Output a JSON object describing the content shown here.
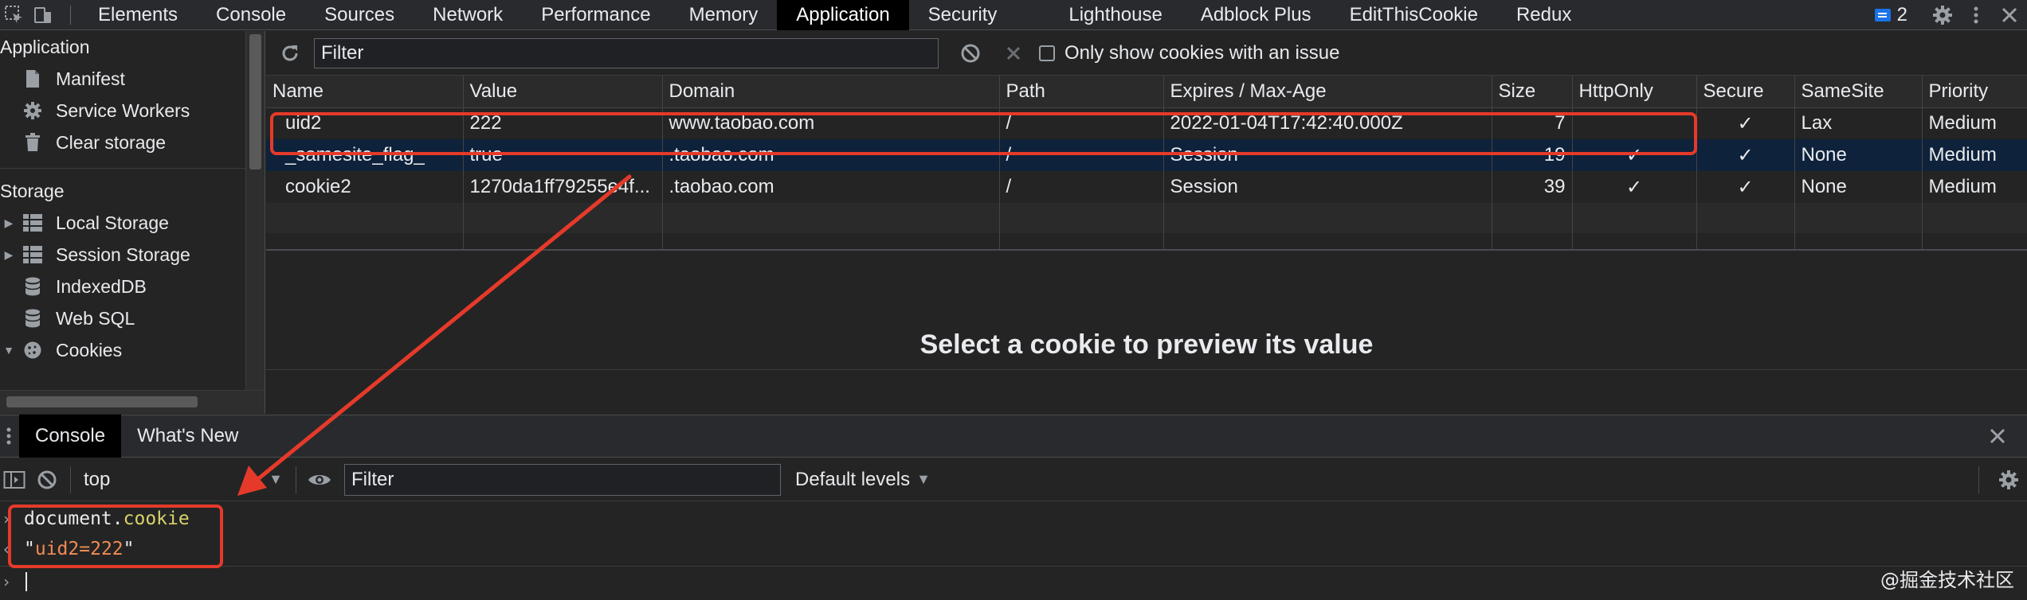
{
  "devtools": {
    "tabs": [
      "Elements",
      "Console",
      "Sources",
      "Network",
      "Performance",
      "Memory",
      "Application",
      "Security",
      "Lighthouse",
      "Adblock Plus",
      "EditThisCookie",
      "Redux"
    ],
    "active_tab": "Application",
    "message_count": "2"
  },
  "sidebar": {
    "application_heading": "Application",
    "application_items": [
      {
        "label": "Manifest",
        "icon": "document-icon"
      },
      {
        "label": "Service Workers",
        "icon": "gear-icon"
      },
      {
        "label": "Clear storage",
        "icon": "trash-icon"
      }
    ],
    "storage_heading": "Storage",
    "storage_items": [
      {
        "label": "Local Storage",
        "icon": "grid-icon",
        "expandable": true
      },
      {
        "label": "Session Storage",
        "icon": "grid-icon",
        "expandable": true
      },
      {
        "label": "IndexedDB",
        "icon": "database-icon",
        "expandable": false
      },
      {
        "label": "Web SQL",
        "icon": "database-icon",
        "expandable": false
      },
      {
        "label": "Cookies",
        "icon": "cookie-icon",
        "expandable": true,
        "expanded": true
      }
    ]
  },
  "cookie_toolbar": {
    "filter_placeholder": "Filter",
    "only_issue_label": "Only show cookies with an issue",
    "only_issue_checked": false
  },
  "cookie_table": {
    "columns": [
      "Name",
      "Value",
      "Domain",
      "Path",
      "Expires / Max-Age",
      "Size",
      "HttpOnly",
      "Secure",
      "SameSite",
      "Priority"
    ],
    "rows": [
      {
        "name": "uid2",
        "value": "222",
        "domain": "www.taobao.com",
        "path": "/",
        "expires": "2022-01-04T17:42:40.000Z",
        "size": "7",
        "httponly": "",
        "secure": "✓",
        "samesite": "Lax",
        "priority": "Medium",
        "selected": false
      },
      {
        "name": "_samesite_flag_",
        "value": "true",
        "domain": ".taobao.com",
        "path": "/",
        "expires": "Session",
        "size": "19",
        "httponly": "✓",
        "secure": "✓",
        "samesite": "None",
        "priority": "Medium",
        "selected": true
      },
      {
        "name": "cookie2",
        "value": "1270da1ff79255e4f...",
        "domain": ".taobao.com",
        "path": "/",
        "expires": "Session",
        "size": "39",
        "httponly": "✓",
        "secure": "✓",
        "samesite": "None",
        "priority": "Medium",
        "selected": false
      }
    ],
    "preview_message": "Select a cookie to preview its value"
  },
  "drawer": {
    "tabs": [
      "Console",
      "What's New"
    ],
    "active_tab": "Console",
    "context": "top",
    "filter_placeholder": "Filter",
    "levels_label": "Default levels"
  },
  "console": {
    "input_object": "document.",
    "input_property": "cookie",
    "output_string": "uid2=222"
  },
  "watermark": "@掘金技术社区",
  "colors": {
    "annotation": "#e53a2a",
    "selected_row": "#0f223c",
    "console_property": "#d9d26c",
    "console_string": "#f28b54"
  }
}
